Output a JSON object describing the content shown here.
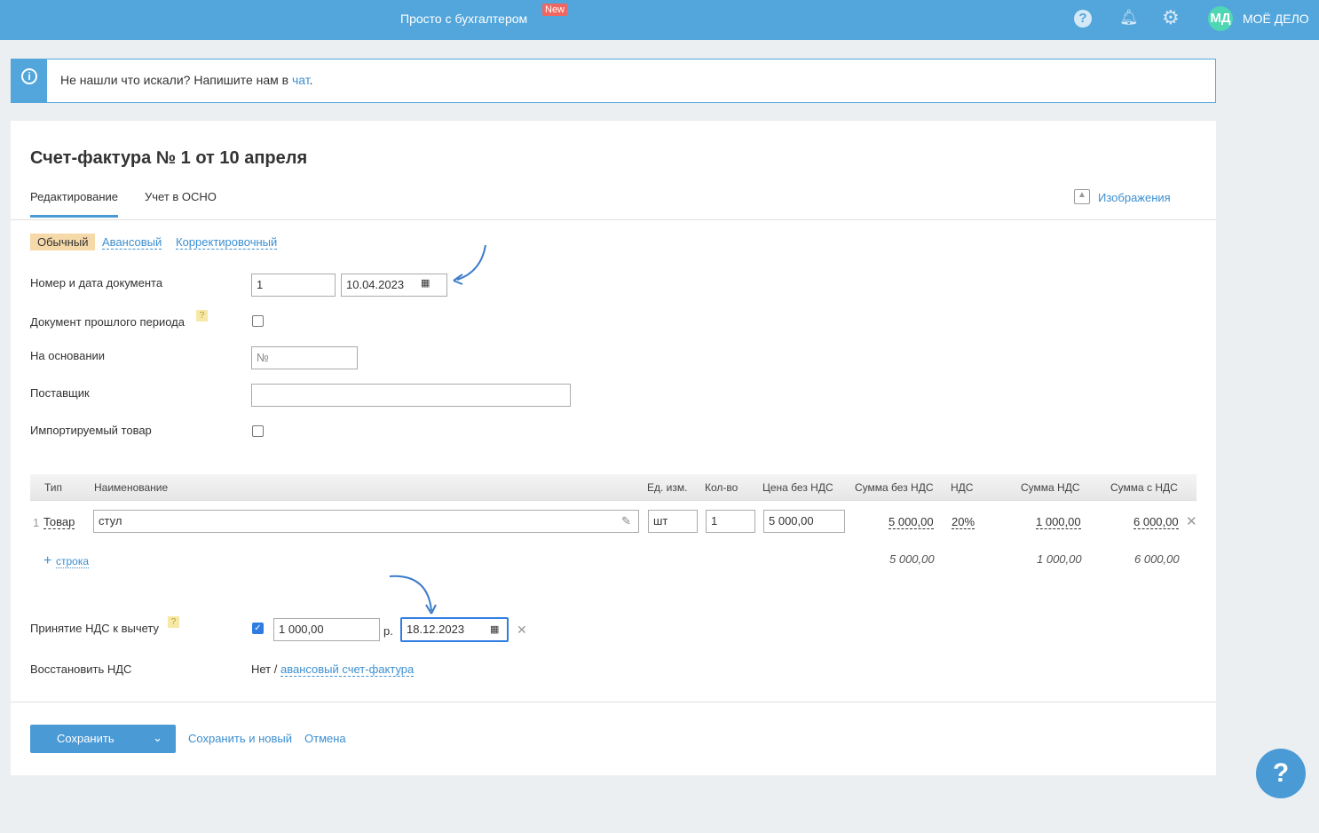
{
  "topbar": {
    "promo": "Просто с бухгалтером",
    "new_badge": "New",
    "brand_initials": "МД",
    "brand": "МОЁ ДЕЛО"
  },
  "banner": {
    "text": "Не нашли что искали? Напишите нам в ",
    "link": "чат",
    "end": "."
  },
  "title": "Счет-фактура № 1 от 10 апреля",
  "tabs": [
    "Редактирование",
    "Учет в ОСНО"
  ],
  "images_link": "Изображения",
  "types": [
    "Обычный",
    "Авансовый",
    "Корректировочный"
  ],
  "form": {
    "doc_label": "Номер и дата документа",
    "doc_number": "1",
    "doc_date": "10.04.2023",
    "past_label": "Документ прошлого периода",
    "q": "?",
    "basis_label": "На основании",
    "basis_placeholder": "№",
    "supplier_label": "Поставщик",
    "supplier_value": "",
    "import_label": "Импортируемый товар"
  },
  "table": {
    "headers": [
      "Тип",
      "Наименование",
      "Ед. изм.",
      "Кол-во",
      "Цена без НДС",
      "Сумма без НДС",
      "НДС",
      "Сумма НДС",
      "Сумма с НДС"
    ],
    "rows": [
      {
        "n": "1",
        "type": "Товар",
        "name": "стул",
        "unit": "шт",
        "qty": "1",
        "price": "5 000,00",
        "sum": "5 000,00",
        "vat": "20%",
        "vat_sum": "1 000,00",
        "total": "6 000,00"
      }
    ],
    "add_row": "строка",
    "totals": {
      "sum": "5 000,00",
      "vat_sum": "1 000,00",
      "total": "6 000,00"
    }
  },
  "deduct": {
    "label": "Принятие НДС к вычету",
    "amount": "1 000,00",
    "currency": "р.",
    "date": "18.12.2023"
  },
  "restore": {
    "label": "Восстановить НДС",
    "value": "Нет",
    "sep": " / ",
    "link": "авансовый счет-фактура"
  },
  "footer": {
    "save": "Сохранить",
    "save_new": "Сохранить и новый",
    "cancel": "Отмена"
  },
  "colors": {
    "accent": "#52a6dc",
    "badge": "#ef6760"
  }
}
